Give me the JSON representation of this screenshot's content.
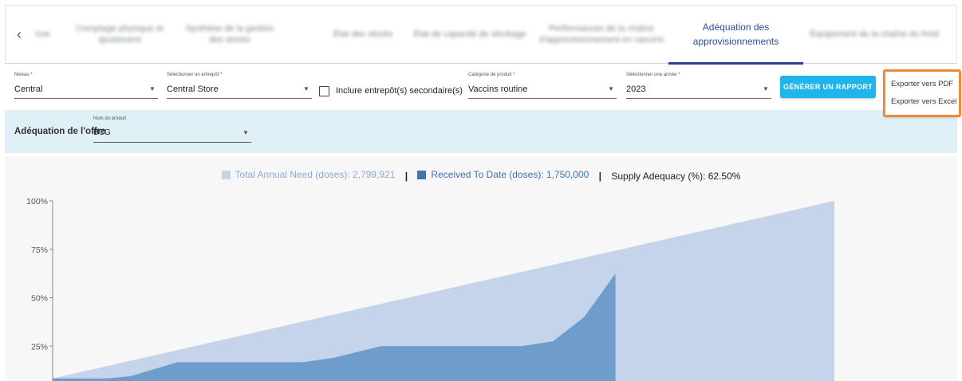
{
  "tabs": {
    "back_icon": "chevron-left-icon",
    "items": [
      {
        "label": "Vue"
      },
      {
        "label": "Comptage physique et ajustement"
      },
      {
        "label": "Synthèse de la gestion des stocks"
      },
      {
        "label": "État des stocks"
      },
      {
        "label": "État de capacité de stockage"
      },
      {
        "label": "Performances de la chaîne d'approvisionnement en vaccins"
      },
      {
        "label": "Adéquation des approvisionnements"
      },
      {
        "label": "Équipement de la chaîne du froid"
      }
    ],
    "active_index": 6
  },
  "filters": {
    "level": {
      "label": "Niveau",
      "value": "Central"
    },
    "store": {
      "label": "Sélectionner un entrepôt",
      "value": "Central Store"
    },
    "secondary": {
      "label": "Inclure entrepôt(s) secondaire(s)",
      "checked": false
    },
    "category": {
      "label": "Catégorie de produit",
      "value": "Vaccins routine"
    },
    "year": {
      "label": "Sélectionner une année",
      "value": "2023"
    },
    "required_mark": "*",
    "generate_button": "GÉNÉRER UN RAPPORT"
  },
  "export_menu": {
    "pdf": "Exporter vers PDF",
    "excel": "Exporter vers Excel"
  },
  "band": {
    "title": "Adéquation de l'offre",
    "product": {
      "label": "Nom du produit",
      "value": "BCG"
    }
  },
  "colors": {
    "accent": "#2d3f97",
    "button": "#1fb5ea",
    "highlight": "#ee8c35",
    "band": "#dff0f7",
    "need_area": "#c5d4ea",
    "received_area": "#6f9dcb"
  },
  "chart_data": {
    "type": "area",
    "legend": {
      "total": "Total Annual Need (doses): 2,799,921",
      "received": "Received To Date (doses): 1,750,000",
      "adequacy": "Supply Adequacy (%): 62.50%",
      "separator": "|"
    },
    "y_ticks": [
      "100%",
      "75%",
      "50%",
      "25%"
    ],
    "y_tick_values": [
      100,
      75,
      50,
      25
    ],
    "ylim": [
      0,
      100
    ],
    "grid": false,
    "legend_placement": "top-center",
    "series": [
      {
        "name": "Total Annual Need (doses): 2,799,921",
        "color": "#c5d4ea",
        "points": [
          [
            0,
            8.3
          ],
          [
            1,
            100
          ]
        ]
      },
      {
        "name": "Received To Date (doses): 1,750,000",
        "color": "#6f9dcb",
        "points": [
          [
            0,
            8.3
          ],
          [
            0.07,
            8.3
          ],
          [
            0.1,
            9.5
          ],
          [
            0.16,
            16.7
          ],
          [
            0.32,
            16.7
          ],
          [
            0.36,
            19.0
          ],
          [
            0.42,
            25.0
          ],
          [
            0.6,
            25.0
          ],
          [
            0.64,
            27.5
          ],
          [
            0.68,
            40.0
          ],
          [
            0.72,
            62.5
          ],
          [
            0.72,
            0
          ]
        ]
      }
    ]
  }
}
